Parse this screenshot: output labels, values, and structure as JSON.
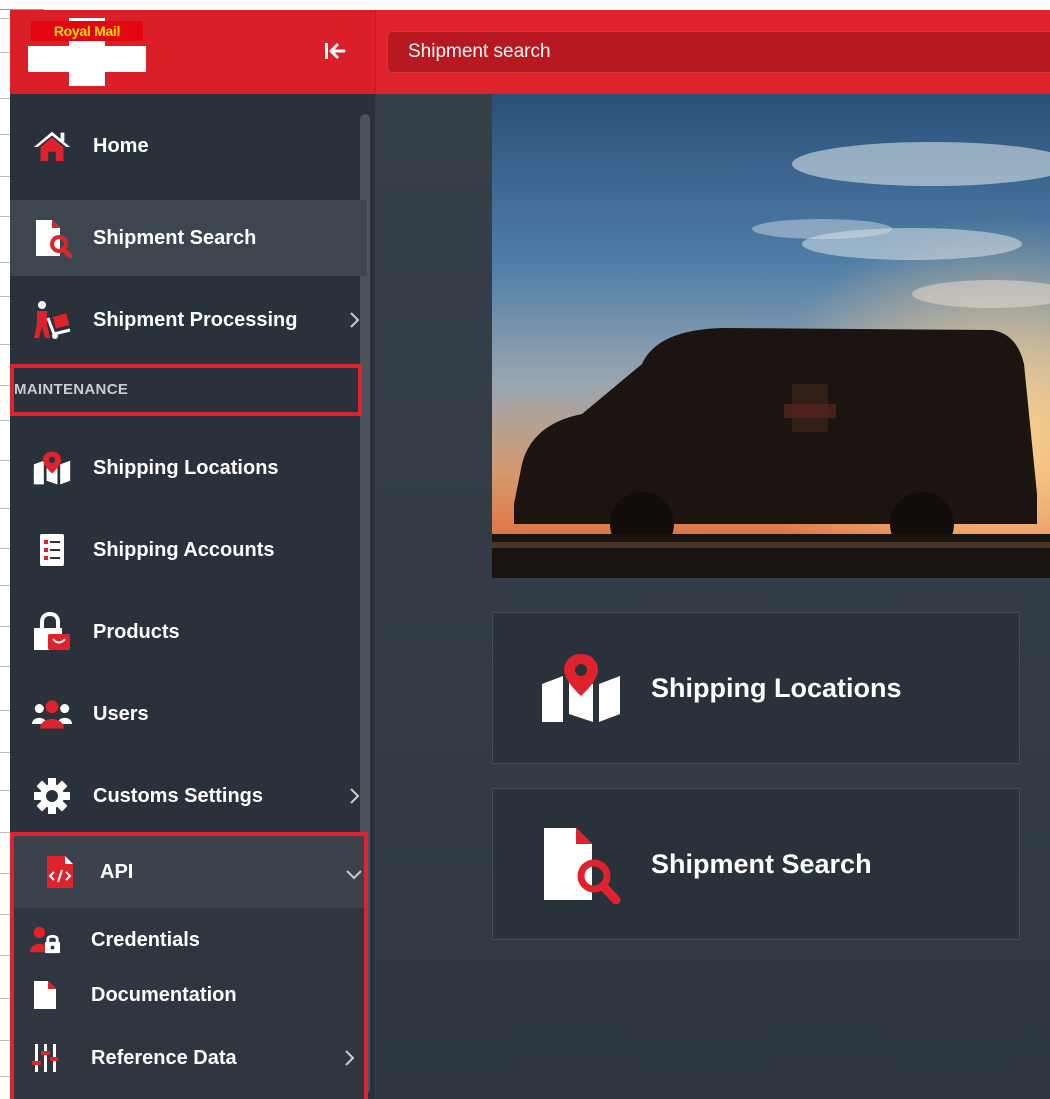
{
  "header": {
    "logo_text": "Royal Mail",
    "collapse_icon": "collapse-left-icon",
    "search_title": "Shipment search"
  },
  "sidebar": {
    "items": [
      {
        "label": "Home",
        "icon": "home-icon"
      },
      {
        "label": "Shipment Search",
        "icon": "document-search-icon",
        "active": true
      },
      {
        "label": "Shipment Processing",
        "icon": "delivery-person-icon",
        "has_submenu": true
      }
    ],
    "section_label": "MAINTENANCE",
    "maintenance_items": [
      {
        "label": "Shipping Locations",
        "icon": "map-pin-icon"
      },
      {
        "label": "Shipping Accounts",
        "icon": "list-icon"
      },
      {
        "label": "Products",
        "icon": "shopping-bag-icon"
      },
      {
        "label": "Users",
        "icon": "users-icon"
      },
      {
        "label": "Customs Settings",
        "icon": "gear-icon",
        "has_submenu": true
      }
    ],
    "api": {
      "label": "API",
      "icon": "code-file-icon",
      "expanded": true,
      "children": [
        {
          "label": "Credentials",
          "icon": "user-lock-icon"
        },
        {
          "label": "Documentation",
          "icon": "document-icon"
        },
        {
          "label": "Reference Data",
          "icon": "sliders-icon",
          "has_submenu": true
        }
      ]
    }
  },
  "main": {
    "hero_image": "delivery-van-at-sunset",
    "cards": [
      {
        "label": "Shipping Locations",
        "icon": "map-pin-icon"
      },
      {
        "label": "Shipment Search",
        "icon": "document-search-icon"
      }
    ]
  },
  "colors": {
    "brand_red": "#e0222c",
    "sidebar_bg": "#29313a",
    "active_item_bg": "#3d454e",
    "main_bg": "#333d47",
    "text": "#ffffff"
  }
}
